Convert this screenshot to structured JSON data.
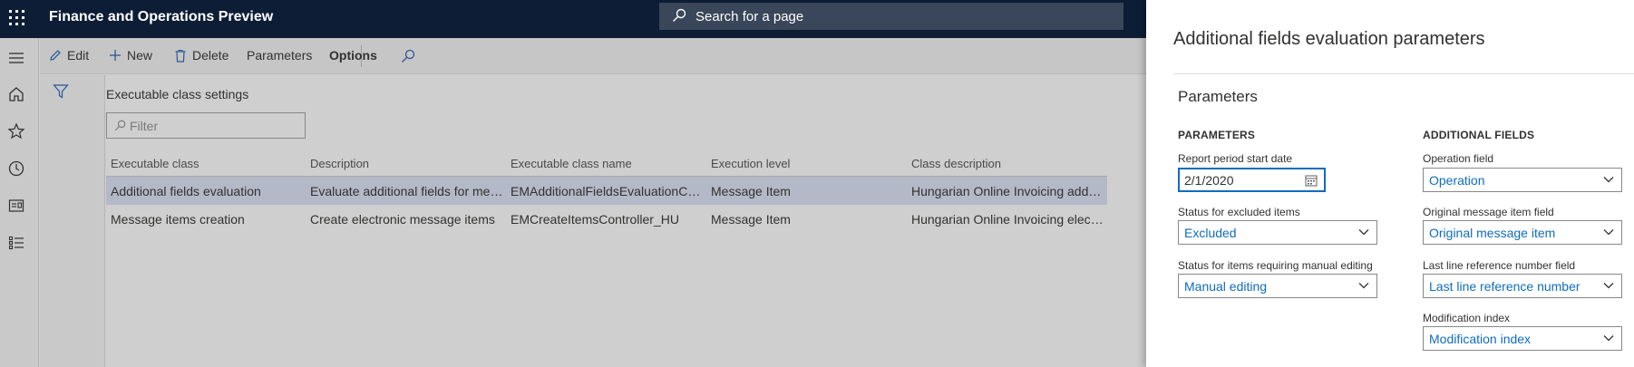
{
  "app": {
    "title": "Finance and Operations Preview",
    "search_placeholder": "Search for a page"
  },
  "actions": {
    "edit": "Edit",
    "new": "New",
    "delete": "Delete",
    "parameters": "Parameters",
    "options": "Options"
  },
  "main": {
    "section_title": "Executable class settings",
    "filter_placeholder": "Filter",
    "columns": [
      "Executable class",
      "Description",
      "Executable class name",
      "Execution level",
      "Class description"
    ],
    "rows": [
      [
        "Additional fields evaluation",
        "Evaluate additional fields for message items",
        "EMAdditionalFieldsEvaluationController",
        "Message Item",
        "Hungarian Online Invoicing additional fields evaluation"
      ],
      [
        "Message items creation",
        "Create electronic message items",
        "EMCreateItemsController_HU",
        "Message Item",
        "Hungarian Online Invoicing electronic message items creation"
      ]
    ],
    "selected_row": 0
  },
  "panel": {
    "title": "Additional fields evaluation parameters",
    "subtitle": "Parameters",
    "left_group": {
      "heading": "PARAMETERS",
      "report_period_label": "Report period start date",
      "report_period_value": "2/1/2020",
      "excluded_label": "Status for excluded items",
      "excluded_value": "Excluded",
      "manual_label": "Status for items requiring manual editing",
      "manual_value": "Manual editing"
    },
    "right_group": {
      "heading": "ADDITIONAL FIELDS",
      "operation_label": "Operation field",
      "operation_value": "Operation",
      "original_label": "Original message item field",
      "original_value": "Original message item",
      "lastline_label": "Last line reference number field",
      "lastline_value": "Last line reference number",
      "modification_label": "Modification index",
      "modification_value": "Modification index"
    }
  },
  "colors": {
    "topbar": "#0d1d35",
    "accent": "#0f6cbd",
    "selected_row": "#b4b9c8"
  }
}
